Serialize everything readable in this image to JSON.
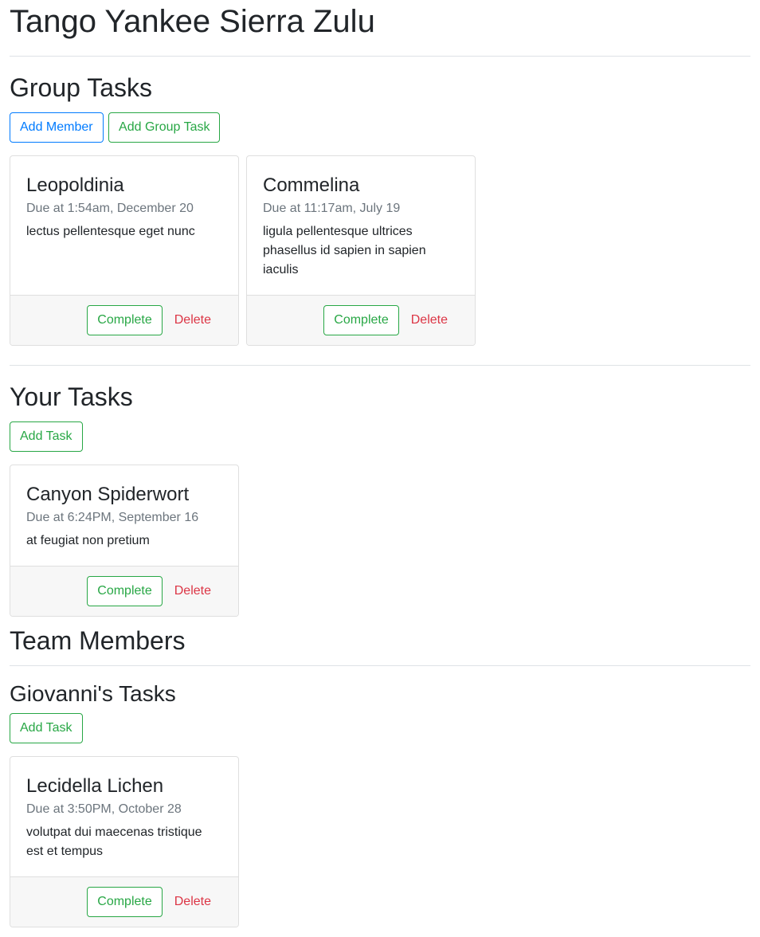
{
  "group": {
    "title": "Tango Yankee Sierra Zulu"
  },
  "group_tasks": {
    "heading": "Group Tasks",
    "add_member_label": "Add Member",
    "add_group_task_label": "Add Group Task",
    "tasks": [
      {
        "title": "Leopoldinia",
        "due": "Due at 1:54am, December 20",
        "description": "lectus pellentesque eget nunc",
        "complete_label": "Complete",
        "delete_label": "Delete"
      },
      {
        "title": "Commelina",
        "due": "Due at 11:17am, July 19",
        "description": "ligula pellentesque ultrices phasellus id sapien in sapien iaculis",
        "complete_label": "Complete",
        "delete_label": "Delete"
      }
    ]
  },
  "your_tasks": {
    "heading": "Your Tasks",
    "add_task_label": "Add Task",
    "tasks": [
      {
        "title": "Canyon Spiderwort",
        "due": "Due at 6:24PM, September 16",
        "description": "at feugiat non pretium",
        "complete_label": "Complete",
        "delete_label": "Delete"
      }
    ]
  },
  "team_members": {
    "heading": "Team Members",
    "members": [
      {
        "heading": "Giovanni's Tasks",
        "add_task_label": "Add Task",
        "tasks": [
          {
            "title": "Lecidella Lichen",
            "due": "Due at 3:50PM, October 28",
            "description": "volutpat dui maecenas tristique est et tempus",
            "complete_label": "Complete",
            "delete_label": "Delete"
          }
        ]
      }
    ]
  },
  "colors": {
    "primary": "#007bff",
    "success": "#28a745",
    "danger": "#dc3545",
    "muted_text": "#6c757d",
    "card_footer_bg": "#f7f7f7"
  }
}
